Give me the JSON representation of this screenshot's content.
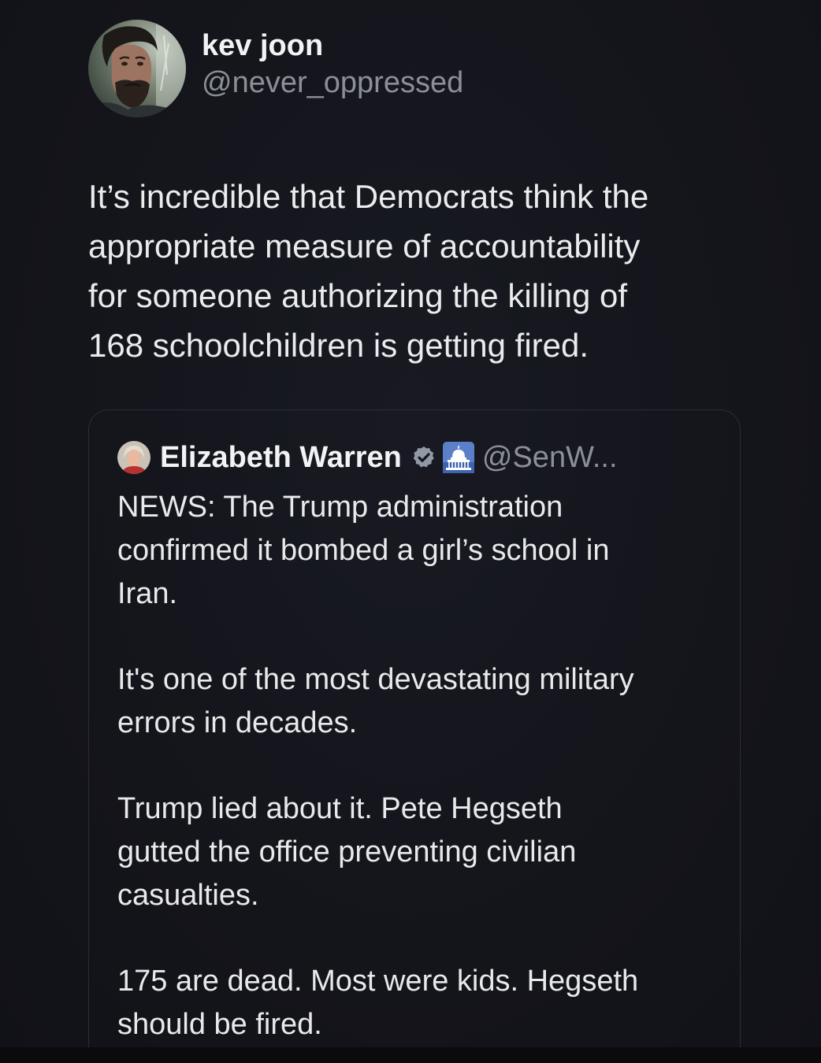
{
  "author": {
    "display_name": "kev joon",
    "handle": "@never_oppressed",
    "avatar_icon": "profile-photo-avatar"
  },
  "tweet": {
    "lines": [
      "It’s incredible that Democrats think the",
      "appropriate measure of accountability",
      "for someone authorizing the killing of",
      "168 schoolchildren is getting fired."
    ]
  },
  "quote": {
    "display_name": "Elizabeth Warren",
    "handle": "@SenW...",
    "verified_icon": "verified-badge-icon",
    "affiliation_icon": "us-capitol-icon",
    "paragraphs": [
      {
        "lines": [
          "NEWS: The Trump administration",
          "confirmed it bombed a girl’s school in",
          "Iran."
        ]
      },
      {
        "lines": [
          "It's one of the most devastating military",
          "errors in decades."
        ]
      },
      {
        "lines": [
          "Trump lied about it. Pete Hegseth",
          "gutted the office preventing civilian",
          "casualties."
        ]
      },
      {
        "lines": [
          "175 are dead. Most were kids. Hegseth",
          "should be fired."
        ]
      }
    ]
  },
  "colors": {
    "background": "#15161c",
    "text_primary": "#e7e9ea",
    "text_secondary": "#8b9096",
    "border": "#2b2e35",
    "verified": "#8f9aa6"
  }
}
